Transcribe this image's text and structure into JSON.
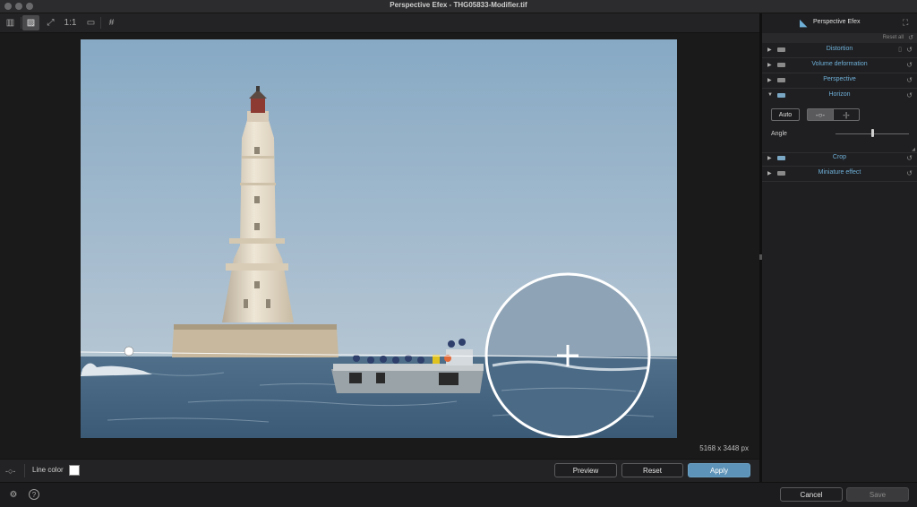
{
  "window": {
    "title": "Perspective Efex - THG05833-Modifier.tif"
  },
  "toolbar": {
    "buttons": [
      {
        "name": "panel-toggle",
        "glyph": "▥"
      },
      {
        "name": "image-view",
        "glyph": "▨"
      },
      {
        "name": "fit-view",
        "glyph": "⤢"
      },
      {
        "name": "zoom-one-to-one",
        "glyph": "1:1"
      },
      {
        "name": "compare-view",
        "glyph": "▭"
      },
      {
        "name": "grid-view",
        "glyph": "#"
      }
    ]
  },
  "canvas": {
    "dimensions": "5168 x 3448 px",
    "handle_symbol": "+"
  },
  "bottom_bar": {
    "line_icon": "-○-",
    "line_color_label": "Line color",
    "line_color": "#ffffff",
    "preview_label": "Preview",
    "reset_label": "Reset",
    "apply_label": "Apply"
  },
  "status_bar": {
    "settings_icon": "⚙",
    "help_icon": "?",
    "cancel_label": "Cancel",
    "save_label": "Save"
  },
  "panel": {
    "title": "Perspective Efex",
    "logo": "◣",
    "expand_icon": "⛶",
    "reset_all_label": "Reset all",
    "reset_icon": "↺",
    "sections": [
      {
        "label": "Distortion",
        "expanded": false
      },
      {
        "label": "Volume deformation",
        "expanded": false
      },
      {
        "label": "Perspective",
        "expanded": false
      },
      {
        "label": "Horizon",
        "expanded": true
      },
      {
        "label": "Crop",
        "expanded": false
      },
      {
        "label": "Miniature effect",
        "expanded": false
      }
    ],
    "horizon": {
      "auto_label": "Auto",
      "mode_horizontal_glyph": "-○-",
      "mode_vertical_glyph": "-|-",
      "angle_label": "Angle",
      "angle_value": 0.5
    }
  },
  "colors": {
    "accent": "#6fb0d8",
    "apply_button": "#5d93b8",
    "background": "#1b1b1d"
  }
}
